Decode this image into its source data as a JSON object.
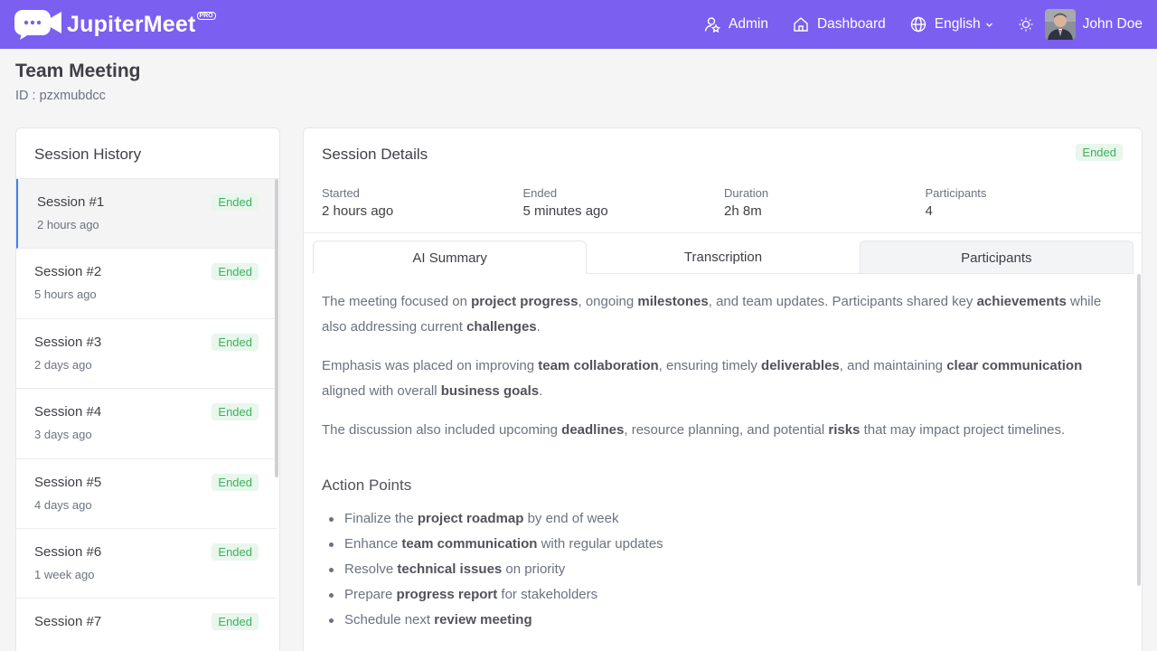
{
  "brand": {
    "name": "JupiterMeet",
    "badge": "PRO"
  },
  "nav": {
    "admin": "Admin",
    "dashboard": "Dashboard",
    "language": "English",
    "user": "John Doe"
  },
  "page": {
    "title": "Team Meeting",
    "id": "ID : pzxmubdcc"
  },
  "history": {
    "title": "Session History",
    "sessions": [
      {
        "name": "Session #1",
        "time": "2 hours ago",
        "status": "Ended"
      },
      {
        "name": "Session #2",
        "time": "5 hours ago",
        "status": "Ended"
      },
      {
        "name": "Session #3",
        "time": "2 days ago",
        "status": "Ended"
      },
      {
        "name": "Session #4",
        "time": "3 days ago",
        "status": "Ended"
      },
      {
        "name": "Session #5",
        "time": "4 days ago",
        "status": "Ended"
      },
      {
        "name": "Session #6",
        "time": "1 week ago",
        "status": "Ended"
      },
      {
        "name": "Session #7",
        "time": "",
        "status": "Ended"
      }
    ]
  },
  "details": {
    "title": "Session Details",
    "status": "Ended",
    "stats": [
      {
        "label": "Started",
        "value": "2 hours ago"
      },
      {
        "label": "Ended",
        "value": "5 minutes ago"
      },
      {
        "label": "Duration",
        "value": "2h 8m"
      },
      {
        "label": "Participants",
        "value": "4"
      }
    ],
    "tabs": [
      "AI Summary",
      "Transcription",
      "Participants"
    ],
    "summary": [
      [
        "The meeting focused on ",
        "project progress",
        ", ongoing ",
        "milestones",
        ", and team updates. Participants shared key ",
        "achievements",
        " while also addressing current ",
        "challenges",
        "."
      ],
      [
        "Emphasis was placed on improving ",
        "team collaboration",
        ", ensuring timely ",
        "deliverables",
        ", and maintaining ",
        "clear communication",
        " aligned with overall ",
        "business goals",
        "."
      ],
      [
        "The discussion also included upcoming ",
        "deadlines",
        ", resource planning, and potential ",
        "risks",
        " that may impact project timelines."
      ]
    ],
    "action_title": "Action Points",
    "actions": [
      [
        "Finalize the ",
        "project roadmap",
        " by end of week"
      ],
      [
        "Enhance ",
        "team communication",
        " with regular updates"
      ],
      [
        "Resolve ",
        "technical issues",
        " on priority"
      ],
      [
        "Prepare ",
        "progress report",
        " for stakeholders"
      ],
      [
        "Schedule next ",
        "review meeting",
        ""
      ]
    ]
  },
  "colors": {
    "header": "#7b5ff0",
    "accent": "#3b82f6",
    "badge_bg": "#e8f6ec",
    "badge_text": "#3cb15b"
  }
}
